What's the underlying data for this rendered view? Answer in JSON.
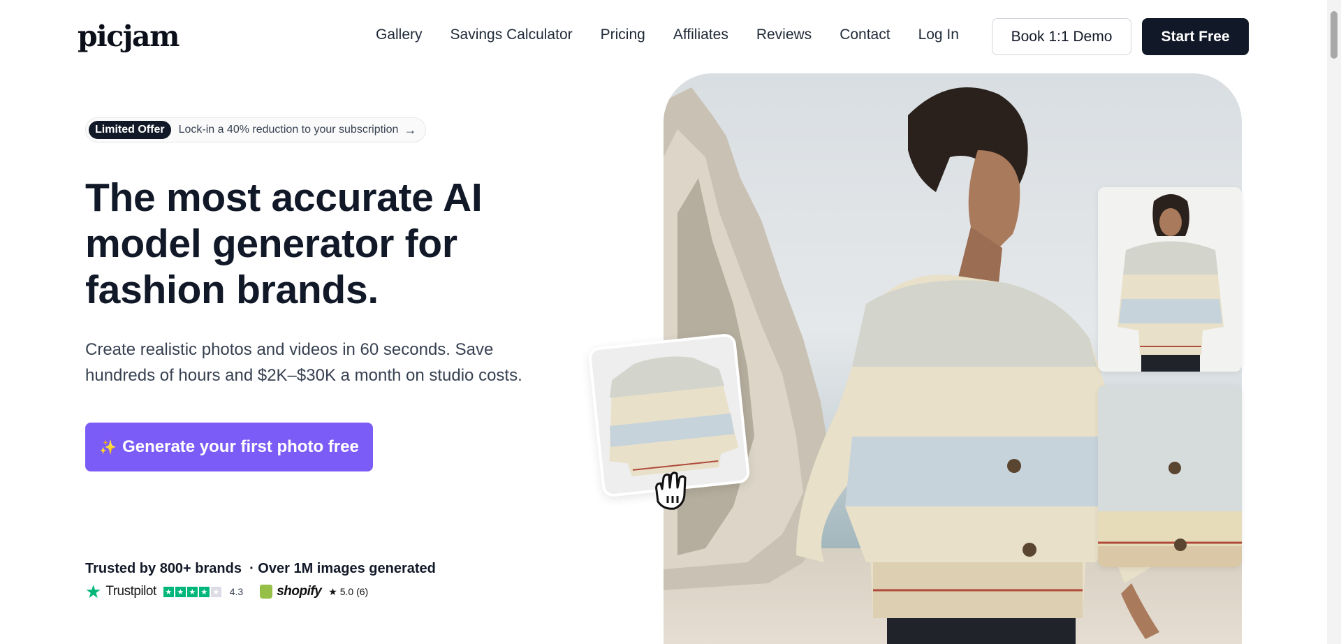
{
  "nav": {
    "logo": "picjam",
    "links": [
      "Gallery",
      "Savings Calculator",
      "Pricing",
      "Affiliates",
      "Reviews",
      "Contact",
      "Log In"
    ],
    "demo_label": "Book 1:1 Demo",
    "start_label": "Start Free"
  },
  "offer": {
    "badge": "Limited Offer",
    "text": "Lock-in a 40% reduction to your subscription",
    "arrow": "→"
  },
  "hero": {
    "title": "The most accurate AI model generator for fashion brands.",
    "subtitle": "Create realistic photos and videos in 60 seconds. Save hundreds of hours and $2K–$30K a month on studio costs.",
    "cta_icon": "✨",
    "cta_label": "Generate your first photo free"
  },
  "trust": {
    "text": "Trusted by 800+ brands  · Over 1M images generated",
    "trustpilot_name": "Trustpilot",
    "trustpilot_score": "4.3",
    "trustpilot_rating": 4.3,
    "shopify_name": "shopify",
    "shopify_score": "★ 5.0 (6)"
  },
  "colors": {
    "accent": "#7c5cf6",
    "dark": "#111827",
    "trustpilot_green": "#00b67a",
    "shopify_green": "#95bf47"
  },
  "icons": [
    "sparkle-icon",
    "arrow-right-icon",
    "trustpilot-star-icon",
    "shopify-bag-icon",
    "grab-hand-icon"
  ]
}
